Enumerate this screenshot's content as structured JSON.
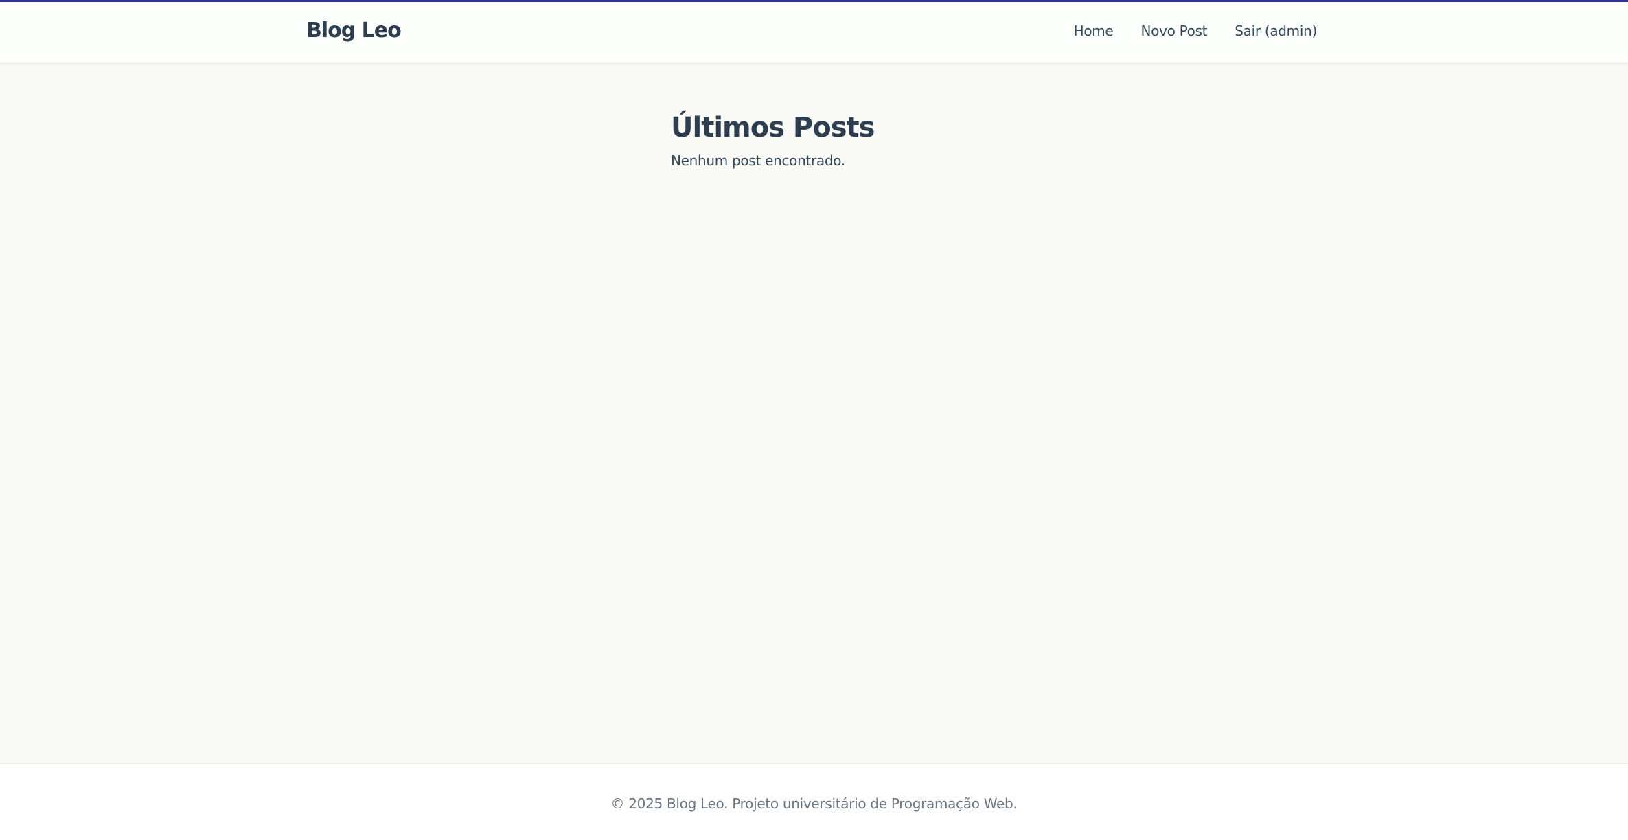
{
  "header": {
    "brand": "Blog Leo",
    "nav": {
      "home": "Home",
      "new_post": "Novo Post",
      "logout": "Sair (admin)"
    }
  },
  "main": {
    "title": "Últimos Posts",
    "empty_message": "Nenhum post encontrado."
  },
  "footer": {
    "text": "© 2025 Blog Leo. Projeto universitário de Programação Web."
  },
  "colors": {
    "accent_bar": "#2b2fa0",
    "page_background": "#f9f9f5",
    "text_primary": "#2c3e50"
  }
}
